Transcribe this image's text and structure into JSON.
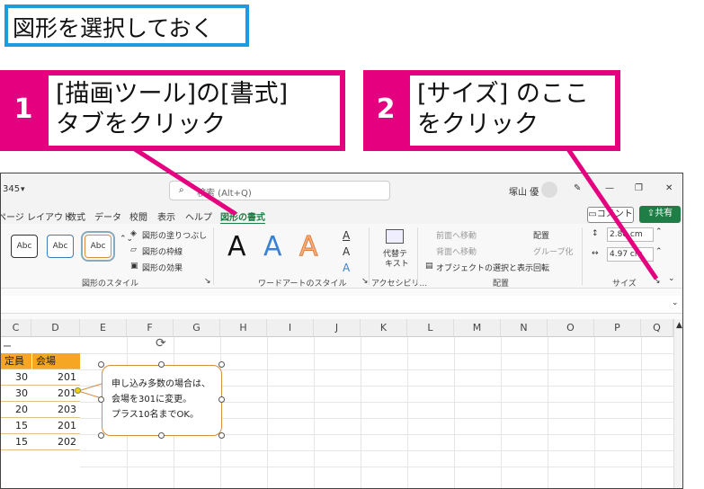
{
  "title": "図形を選択しておく",
  "callout1": {
    "number": "1",
    "line1": "[描画ツール]の[書式]",
    "line2": "タブをクリック"
  },
  "callout2": {
    "number": "2",
    "line1": "[サイズ] のここ",
    "line2": "をクリック"
  },
  "window": {
    "filename_fragment": "345",
    "search_placeholder": "検索 (Alt+Q)",
    "user_name": "塚山 優",
    "window_controls": {
      "minimize": "—",
      "restore": "❐",
      "close": "✕"
    },
    "tabs": [
      "ページ レイアウト",
      "数式",
      "データ",
      "校閲",
      "表示",
      "ヘルプ",
      "図形の書式"
    ],
    "active_tab": "図形の書式",
    "comment_button": "コメント",
    "share_button": "共有",
    "ribbon": {
      "shape_style_samples": [
        "Abc",
        "Abc",
        "Abc"
      ],
      "shape_fill": "図形の塗りつぶし",
      "shape_outline": "図形の枠線",
      "shape_effect": "図形の効果",
      "shape_styles_label": "図形のスタイル",
      "wordart_samples": [
        "A",
        "A",
        "A"
      ],
      "wordart_label": "ワードアートのスタイル",
      "alt_text_line1": "代替テ",
      "alt_text_line2": "キスト",
      "accessibility_label": "アクセシビリ...",
      "bring_forward": "前面へ移動",
      "send_backward": "背面へ移動",
      "selection_pane": "オブジェクトの選択と表示",
      "align": "配置",
      "group": "グループ化",
      "rotate": "回転",
      "arrange_label": "配置",
      "height": "2.88 cm",
      "width": "4.97 cm",
      "size_label": "サイズ"
    },
    "columns": [
      "C",
      "D",
      "E",
      "F",
      "G",
      "H",
      "I",
      "J",
      "K",
      "L",
      "M",
      "N",
      "O",
      "P",
      "Q"
    ],
    "row_fragment": "ー",
    "table_headers": [
      "定員",
      "会場"
    ],
    "table_rows": [
      [
        "30",
        "201"
      ],
      [
        "30",
        "201"
      ],
      [
        "20",
        "203"
      ],
      [
        "15",
        "201"
      ],
      [
        "15",
        "202"
      ]
    ],
    "shape_text": [
      "申し込み多数の場合は、",
      "会場を301に変更。",
      "プラス10名までOK。"
    ]
  },
  "colors": {
    "callout": "#e4007f",
    "title_border": "#1e9be0",
    "table_header": "#f5a623",
    "active_tab": "#1e7e45"
  }
}
